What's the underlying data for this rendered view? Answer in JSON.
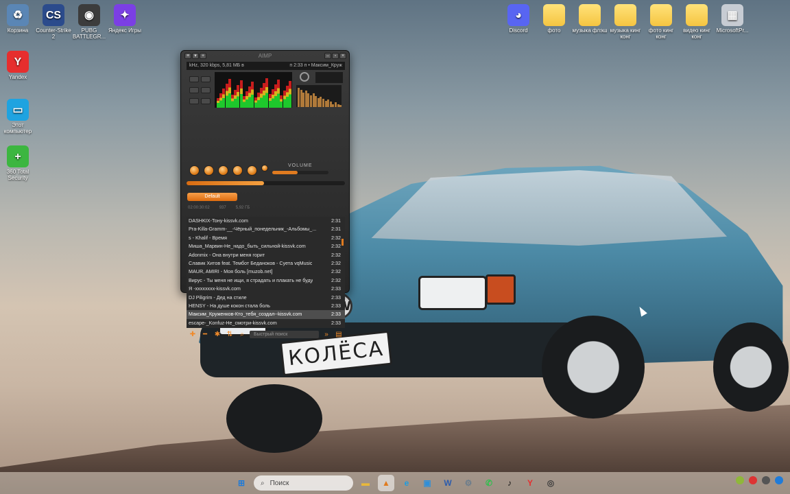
{
  "desktop_left": [
    {
      "label": "Корзина",
      "icon": "recycle-bin-icon",
      "glyph": "♻",
      "color": "#5a86b5"
    },
    {
      "label": "Counter-Strike 2",
      "icon": "counter-strike-icon",
      "glyph": "CS",
      "color": "#2b4b8c"
    },
    {
      "label": "PUBG BATTLEGR...",
      "icon": "pubg-icon",
      "glyph": "◉",
      "color": "#3c3c3c"
    },
    {
      "label": "Яндекс Игры",
      "icon": "yandex-games-icon",
      "glyph": "✦",
      "color": "#7b3fe4"
    }
  ],
  "desktop_column": [
    {
      "label": "Yandex",
      "icon": "yandex-browser-icon",
      "glyph": "Y",
      "color": "#e62e2e"
    },
    {
      "label": "Этот компьютер",
      "icon": "this-pc-icon",
      "glyph": "▭",
      "color": "#1fa3e0"
    },
    {
      "label": "360 Total Security",
      "icon": "security-icon",
      "glyph": "+",
      "color": "#3cb640"
    }
  ],
  "desktop_right": [
    {
      "label": "Discord",
      "icon": "discord-icon",
      "glyph": "◕",
      "color": "#5865f2"
    },
    {
      "label": "фото",
      "icon": "folder-icon"
    },
    {
      "label": "музыка флэш",
      "icon": "folder-icon"
    },
    {
      "label": "музыка кинг конг",
      "icon": "folder-icon"
    },
    {
      "label": "фото кинг конг",
      "icon": "folder-icon"
    },
    {
      "label": "видео кинг конг",
      "icon": "folder-icon"
    },
    {
      "label": "MicrosoftPr...",
      "icon": "office-icon",
      "glyph": "▦",
      "color": "#c7ccd3"
    }
  ],
  "aimp": {
    "title": "AIMP",
    "info_left": "kHz, 320 kbps, 5,81 МБ в",
    "info_right": "п 2:33 п • Максим_Круж",
    "volume_label": "VOLUME",
    "seek_progress": 0.49,
    "volume_level": 0.45,
    "playlist_tab": "Default",
    "stats": [
      "02:00:30:02",
      "937",
      "5,92 ГБ"
    ],
    "tracks": [
      {
        "title": "DASHKIX-Тону-kissvk.com",
        "time": "2:31"
      },
      {
        "title": "Pra-Killa-Gramm-__-Чёрный_понедельник_-Альбомы_...",
        "time": "2:31"
      },
      {
        "title": "s - Khalif - Время",
        "time": "2:32"
      },
      {
        "title": "Миша_Марвин-Не_надо_быть_сильной-kissvk.com",
        "time": "2:32"
      },
      {
        "title": "Adonmix - Она внутри меня горит",
        "time": "2:32"
      },
      {
        "title": "Славик Хитов feat. Тембот Беданоков - Суета vqMusic",
        "time": "2:32"
      },
      {
        "title": "MAUR, AMIRI - Моя боль [muzob.net]",
        "time": "2:32"
      },
      {
        "title": "Вирус - Ты меня не ищи, я страдать и плакать не буду",
        "time": "2:32"
      },
      {
        "title": "Я -xxxxxxxx-kissvk.com",
        "time": "2:33"
      },
      {
        "title": "DJ Piligrim - Дед на стиле",
        "time": "2:33"
      },
      {
        "title": "HENSY - На душе кокон стала боль",
        "time": "2:33"
      },
      {
        "title": "Максим_Круженков-Кто_тебя_создал--kissvk.com",
        "time": "2:33",
        "selected": true
      },
      {
        "title": "escape-_Konfuz-Не_смотри-kissvk.com",
        "time": "2:33"
      }
    ],
    "quick_search": "Быстрый поиск"
  },
  "wallpaper": {
    "plate": "КОЛЁСА",
    "logo": "VW"
  },
  "taskbar": {
    "search_placeholder": "Поиск",
    "apps": [
      {
        "name": "windows-start-icon",
        "glyph": "⊞",
        "color": "#1d7ad8"
      },
      {
        "name": "file-explorer-icon",
        "glyph": "▬",
        "color": "#e9b83a"
      },
      {
        "name": "aimp-taskbar-icon",
        "glyph": "▲",
        "color": "#e07b20",
        "active": true
      },
      {
        "name": "edge-icon",
        "glyph": "e",
        "color": "#1b9de2"
      },
      {
        "name": "photos-icon",
        "glyph": "▣",
        "color": "#2f8fd9"
      },
      {
        "name": "word-icon",
        "glyph": "W",
        "color": "#2b5cad"
      },
      {
        "name": "settings-icon",
        "glyph": "⚙",
        "color": "#6b7d8c"
      },
      {
        "name": "whatsapp-icon",
        "glyph": "✆",
        "color": "#2fbf4d"
      },
      {
        "name": "tiktok-icon",
        "glyph": "♪",
        "color": "#111111"
      },
      {
        "name": "yandex-taskbar-icon",
        "glyph": "Y",
        "color": "#e62e2e"
      },
      {
        "name": "steam-icon",
        "glyph": "◎",
        "color": "#3d3d3d"
      }
    ]
  }
}
